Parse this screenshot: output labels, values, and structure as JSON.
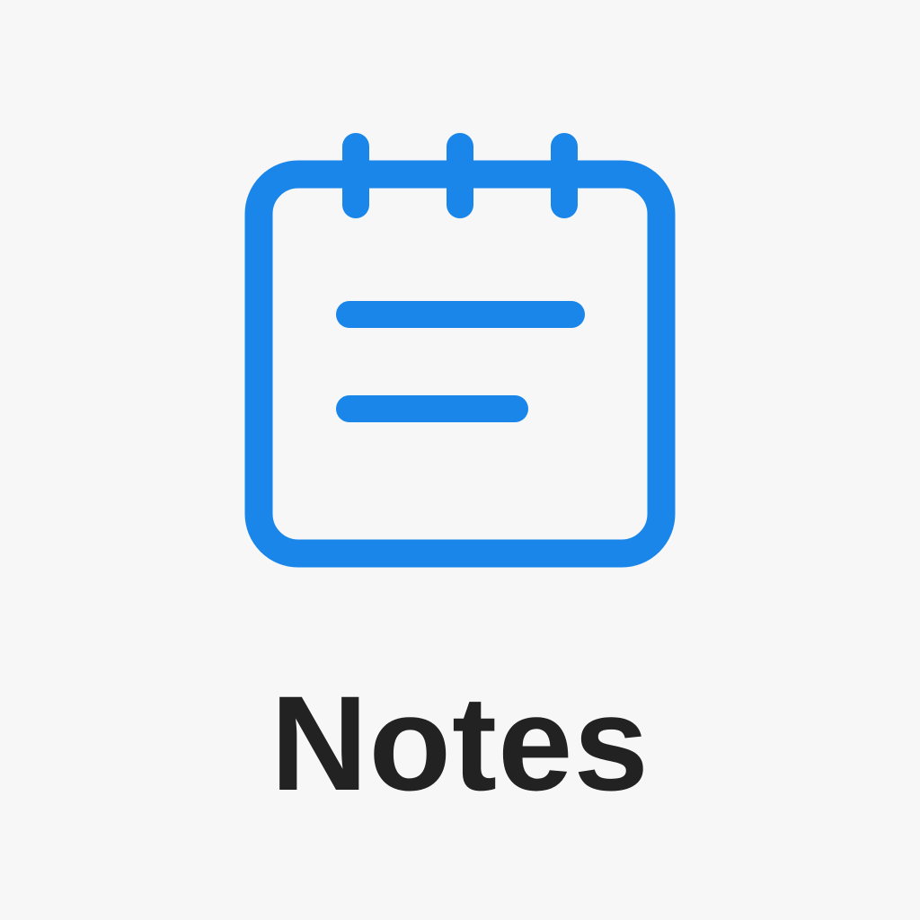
{
  "app": {
    "label": "Notes",
    "icon": "notepad-icon"
  },
  "colors": {
    "background": "#f7f7f8",
    "accent": "#1a86ea",
    "label": "#222222"
  }
}
